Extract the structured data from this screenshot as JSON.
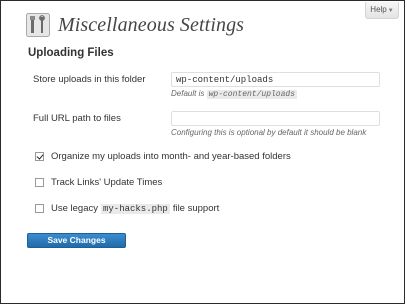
{
  "header": {
    "help_tab": "Help",
    "title": "Miscellaneous Settings",
    "icon": "tools-icon"
  },
  "section": {
    "title": "Uploading Files"
  },
  "fields": {
    "upload_folder": {
      "label": "Store uploads in this folder",
      "value": "wp-content/uploads",
      "hint_prefix": "Default is",
      "hint_code": "wp-content/uploads"
    },
    "url_path": {
      "label": "Full URL path to files",
      "value": "",
      "hint": "Configuring this is optional by default it should be blank"
    }
  },
  "options": {
    "organize": {
      "label": "Organize my uploads into month- and year-based folders",
      "checked": true
    },
    "track_links": {
      "label": "Track Links' Update Times",
      "checked": false
    },
    "legacy": {
      "prefix": "Use legacy",
      "code": "my-hacks.php",
      "suffix": "file support",
      "checked": false
    }
  },
  "actions": {
    "save_label": "Save Changes"
  },
  "colors": {
    "button_blue": "#2e7bbf",
    "border": "#2b2b2b"
  }
}
